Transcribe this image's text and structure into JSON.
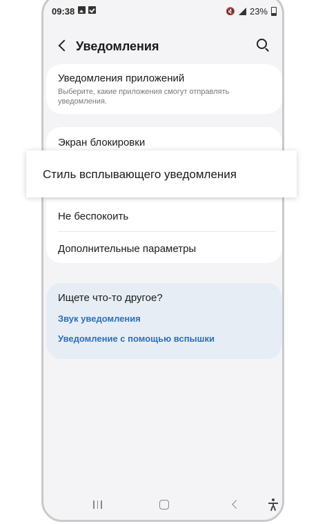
{
  "status_bar": {
    "time": "09:38",
    "battery": "23%",
    "icons": [
      "image-icon",
      "check-icon",
      "mute-icon",
      "signal-icon",
      "battery-icon"
    ]
  },
  "app_bar": {
    "title": "Уведомления"
  },
  "app_notifications": {
    "title": "Уведомления приложений",
    "subtitle": "Выберите, какие приложения смогут отправлять уведомления."
  },
  "lock_screen": {
    "title": "Экран блокировки"
  },
  "popup_style": {
    "title": "Стиль всплывающего уведомления"
  },
  "dnd": {
    "title": "Не беспокоить"
  },
  "advanced": {
    "title": "Дополнительные параметры"
  },
  "suggestions": {
    "title": "Ищете что-то другое?",
    "links": [
      "Звук уведомления",
      "Уведомление с помощью вспышки"
    ]
  },
  "nav": {
    "icons": [
      "recents-icon",
      "home-icon",
      "back-icon",
      "accessibility-icon"
    ]
  },
  "colors": {
    "link": "#2f6fb3",
    "background": "#f4f4f6",
    "suggestion_card": "#e6edf4"
  }
}
